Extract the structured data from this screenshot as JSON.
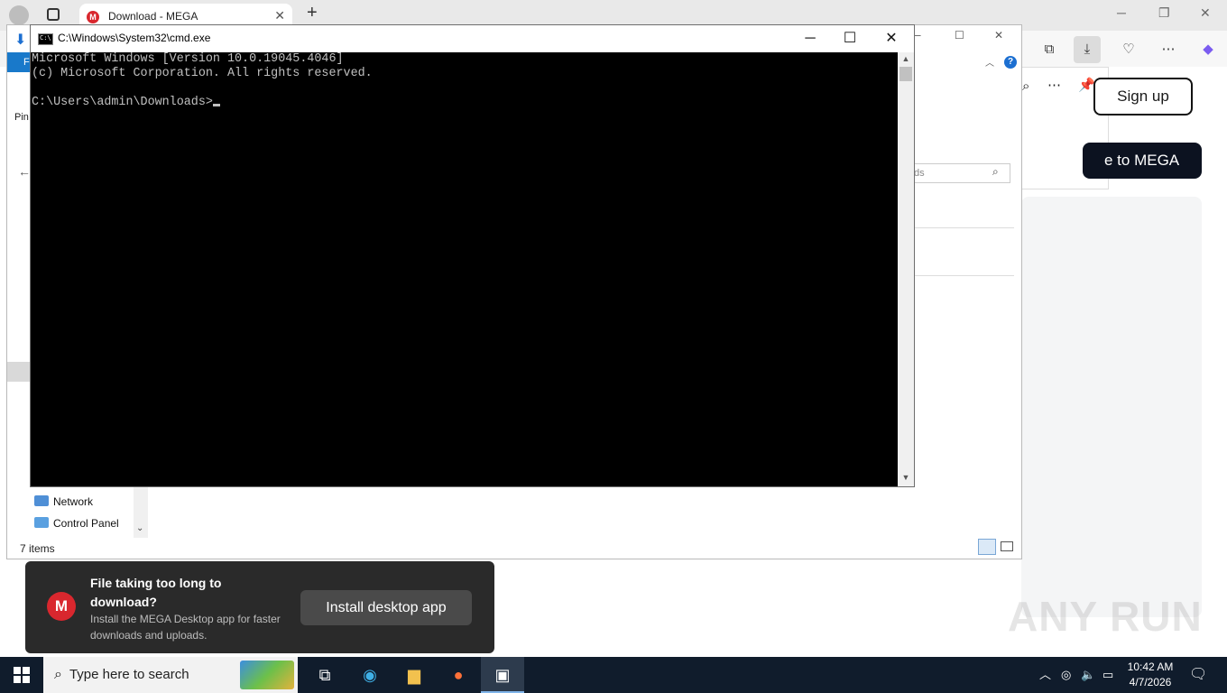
{
  "browser": {
    "tab_title": "Download - MEGA",
    "tab_favicon": "M",
    "new_tab": "+",
    "signup_label": "Sign up",
    "mega_button_label": "e to MEGA"
  },
  "explorer": {
    "ribbon_tab_initial": "F",
    "pin_label": "Pin",
    "search_placeholder": "ds",
    "nav_items": [
      "Network",
      "Control Panel"
    ],
    "status": "7 items",
    "help": "?"
  },
  "cmd": {
    "title": "C:\\Windows\\System32\\cmd.exe",
    "lines": [
      "Microsoft Windows [Version 10.0.19045.4046]",
      "(c) Microsoft Corporation. All rights reserved.",
      "",
      "C:\\Users\\admin\\Downloads>"
    ]
  },
  "toast": {
    "title": "File taking too long to download?",
    "subtitle": "Install the MEGA Desktop app for faster downloads and uploads.",
    "button": "Install desktop app",
    "logo": "M"
  },
  "taskbar": {
    "search_placeholder": "Type here to search",
    "time": "10:42 AM",
    "date": "4/7/2026"
  },
  "watermark": "ANY RUN",
  "colors": {
    "mega_red": "#d9272e",
    "taskbar": "#101c2c",
    "explorer_accent": "#1979ca"
  }
}
